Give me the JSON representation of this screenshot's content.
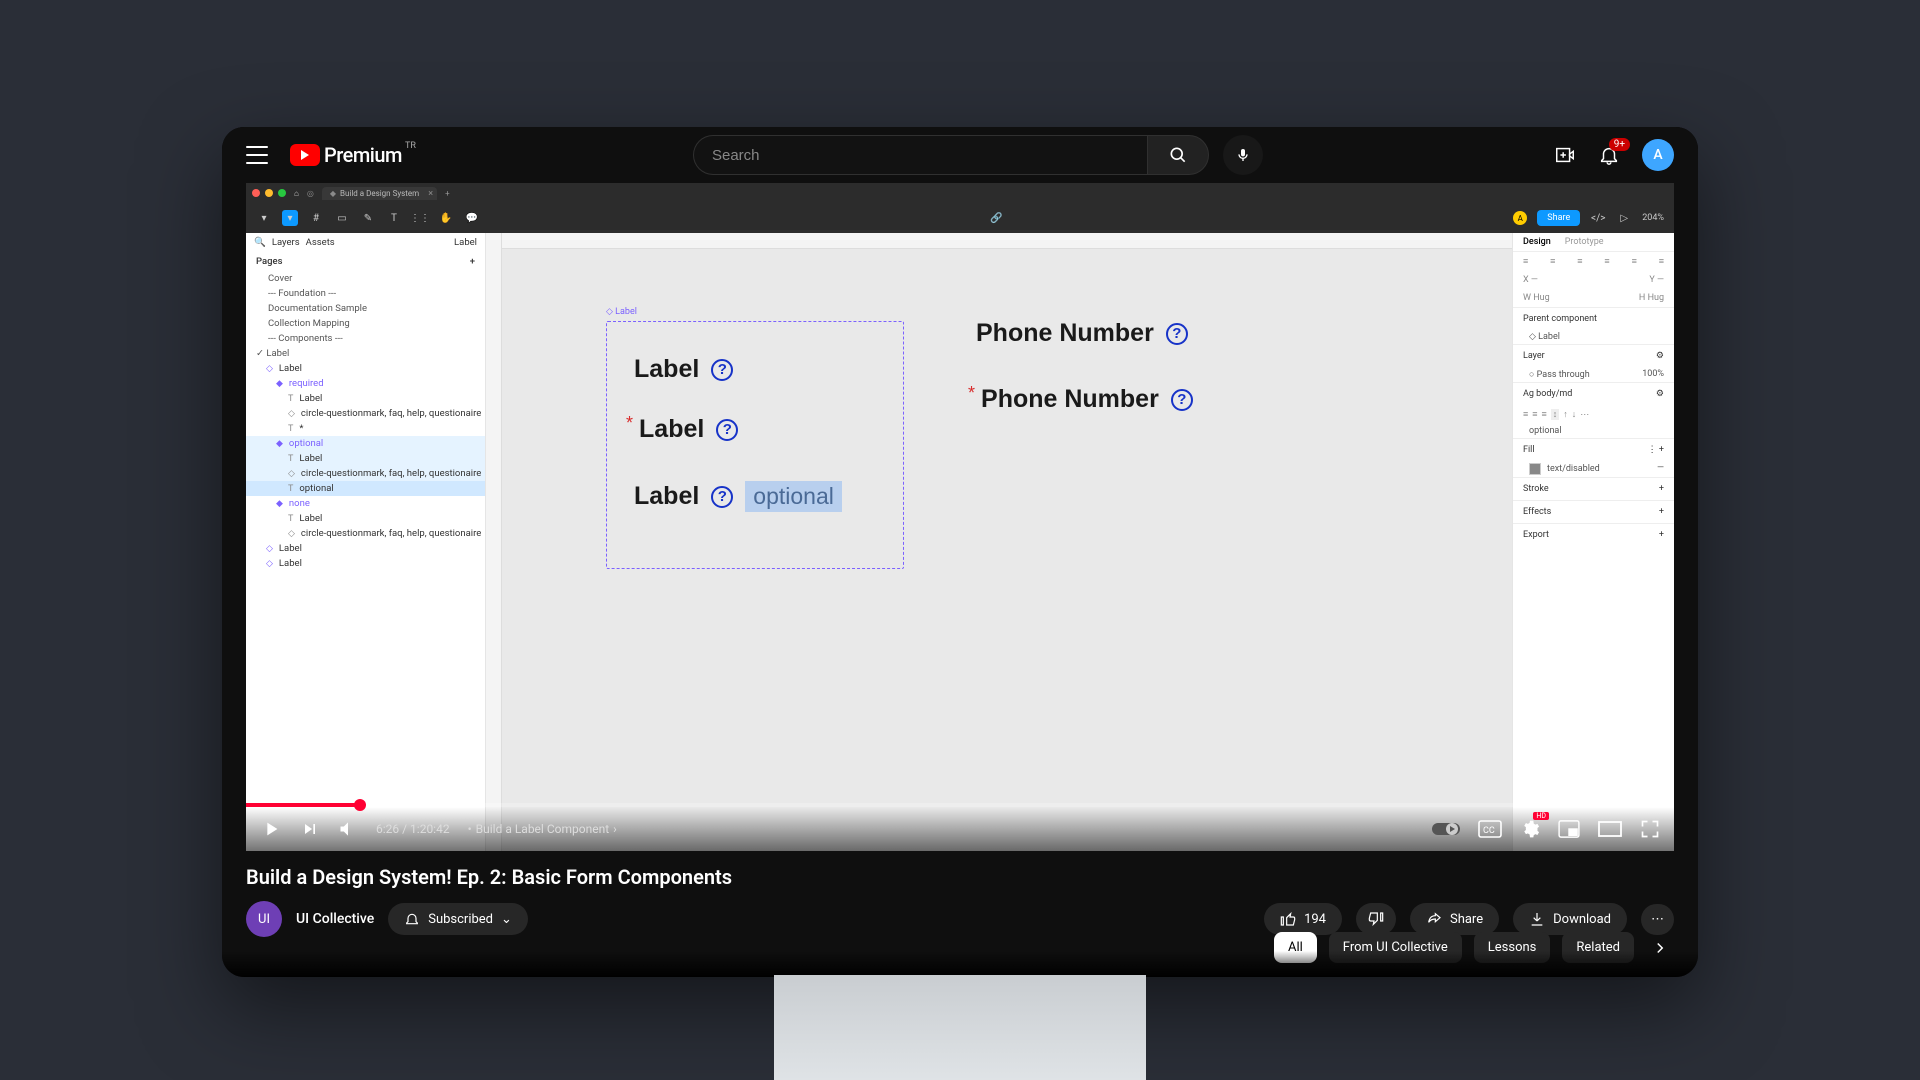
{
  "header": {
    "logo_text": "Premium",
    "logo_region": "TR",
    "search_placeholder": "Search",
    "notification_badge": "9+",
    "avatar_letter": "A"
  },
  "video": {
    "title": "Build a Design System! Ep. 2: Basic Form Components",
    "channel": "UI Collective",
    "subscribed_label": "Subscribed",
    "like_count": "194",
    "share_label": "Share",
    "download_label": "Download",
    "current_time": "6:26",
    "duration": "1:20:42",
    "chapter": "Build a Label Component",
    "chips": [
      "All",
      "From UI Collective",
      "Lessons",
      "Related"
    ]
  },
  "figma": {
    "tab_name": "Build a Design System",
    "share": "Share",
    "zoom": "204%",
    "left_tabs": {
      "layers": "Layers",
      "assets": "Assets",
      "crumb": "Label"
    },
    "pages_label": "Pages",
    "pages": [
      "Cover",
      "--- Foundation ---",
      "Documentation Sample",
      "Collection Mapping",
      "--- Components ---",
      "Label"
    ],
    "layers_root": "Label",
    "variants": {
      "required": "required",
      "optional": "optional",
      "none": "none"
    },
    "layer_label": "Label",
    "layer_icon_desc": "circle-questionmark, faq, help, questionaire",
    "layer_star": "*",
    "layer_optional_text": "optional",
    "canvas": {
      "component_name": "Label",
      "label_text": "Label",
      "optional_text": "optional",
      "instance1": "Phone Number",
      "instance2": "Phone Number"
    },
    "right": {
      "tabs": {
        "design": "Design",
        "prototype": "Prototype"
      },
      "hug": "Hug",
      "parent_component": "Parent component",
      "parent_name": "Label",
      "layer_section": "Layer",
      "pass_through": "Pass through",
      "opacity": "100%",
      "typography": "body/md",
      "text_value": "optional",
      "fill": "Fill",
      "fill_name": "text/disabled",
      "stroke": "Stroke",
      "effects": "Effects",
      "export": "Export"
    }
  }
}
